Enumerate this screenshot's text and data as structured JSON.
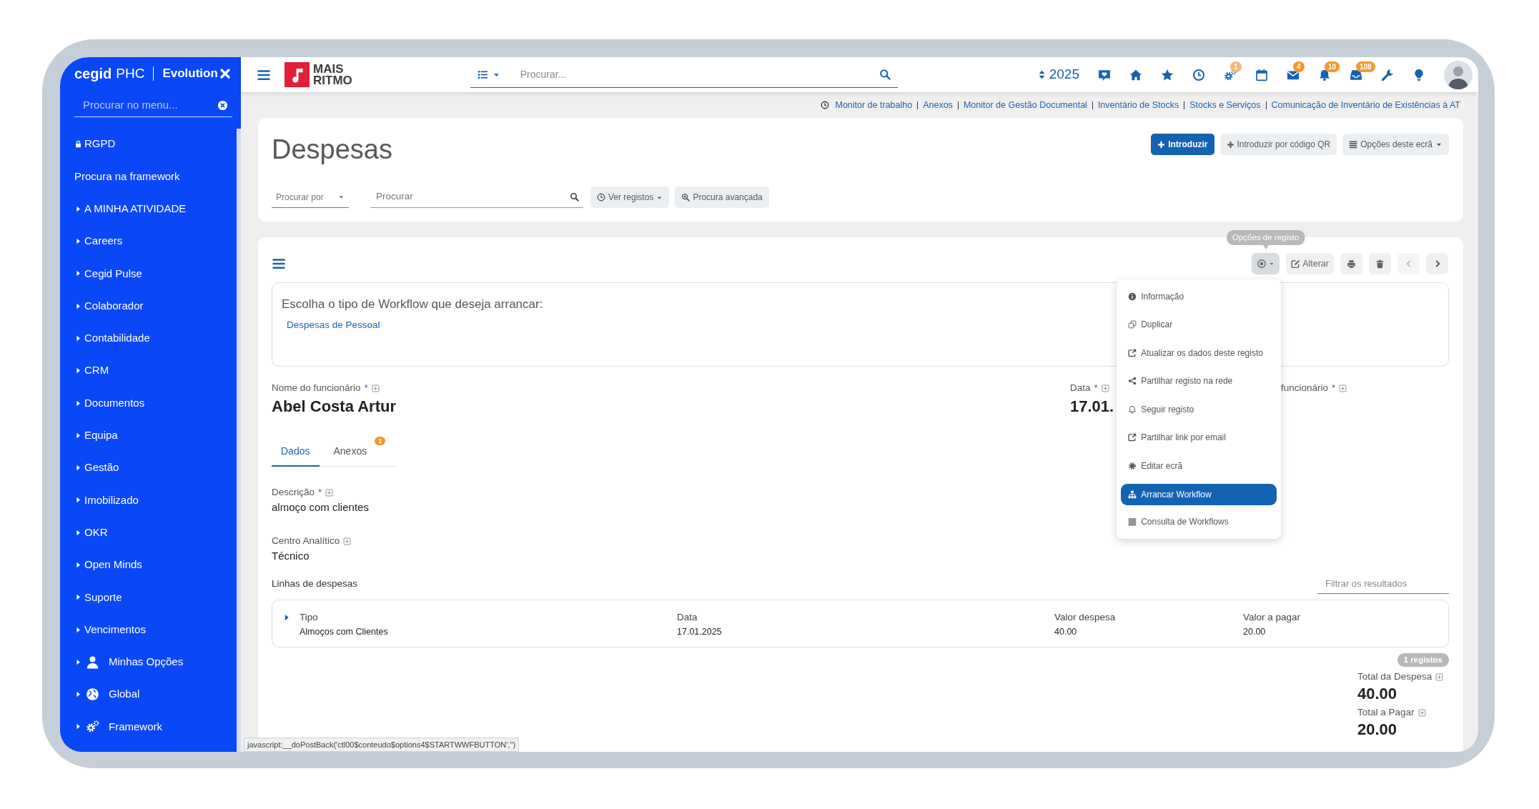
{
  "sidebar": {
    "brand": "cegid",
    "product": "PHC",
    "edition": "Evolution",
    "search": {
      "placeholder": "Procurar no menu..."
    },
    "items": [
      {
        "label": "RGPD",
        "kind": "link"
      },
      {
        "label": "Procura na framework",
        "kind": "link"
      },
      {
        "label": "A MINHA ATIVIDADE",
        "kind": "group"
      },
      {
        "label": "Careers",
        "kind": "group"
      },
      {
        "label": "Cegid Pulse",
        "kind": "group"
      },
      {
        "label": "Colaborador",
        "kind": "group"
      },
      {
        "label": "Contabilidade",
        "kind": "group"
      },
      {
        "label": "CRM",
        "kind": "group"
      },
      {
        "label": "Documentos",
        "kind": "group"
      },
      {
        "label": "Equipa",
        "kind": "group"
      },
      {
        "label": "Gestão",
        "kind": "group"
      },
      {
        "label": "Imobilizado",
        "kind": "group"
      },
      {
        "label": "OKR",
        "kind": "group"
      },
      {
        "label": "Open Minds",
        "kind": "group"
      },
      {
        "label": "Suporte",
        "kind": "group"
      },
      {
        "label": "Vencimentos",
        "kind": "group"
      },
      {
        "label": "Minhas Opções",
        "kind": "group"
      },
      {
        "label": "Global",
        "kind": "group"
      },
      {
        "label": "Framework",
        "kind": "group"
      }
    ]
  },
  "header": {
    "logo": [
      "MAIS",
      "RITMO"
    ],
    "search": {
      "placeholder": "Procurar..."
    },
    "year": "2025",
    "badges": [
      {
        "text": "1",
        "color": "#f6b47a"
      },
      {
        "text": "4",
        "color": "#f3982c"
      },
      {
        "text": "10",
        "color": "#f3982c"
      },
      {
        "text": "108",
        "color": "#f3982c"
      }
    ]
  },
  "breadcrumbs": [
    "Monitor de trabalho",
    "Anexos",
    "Monitor de Gestão Documental",
    "Inventário de Stocks",
    "Stocks e Serviços",
    "Comunicação de Inventário de Existências à AT"
  ],
  "list_panel": {
    "title": "Despesas",
    "actions": [
      {
        "label": "Introduzir",
        "kind": "primary"
      },
      {
        "label": "Introduzir por código QR",
        "kind": "qr"
      },
      {
        "label": "Opções deste ecrã",
        "kind": "dropdown"
      }
    ],
    "search_by": {
      "placeholder": "Procurar por"
    },
    "search": {
      "placeholder": "Procurar"
    },
    "buttons": [
      {
        "label": "Ver registos",
        "kind": "records"
      },
      {
        "label": "Procura avançada",
        "kind": "advanced"
      }
    ]
  },
  "record": {
    "edit_label": "Alterar",
    "tooltip": "Opções de registo",
    "menu_open": true,
    "pager": [
      {
        "disabled": true
      },
      {
        "disabled": false
      }
    ],
    "menu": [
      {
        "label": "Informação",
        "selected": false
      },
      {
        "label": "Duplicar",
        "selected": false
      },
      {
        "label": "Atualizar os dados deste registo",
        "selected": false
      },
      {
        "label": "Partilhar registo na rede",
        "selected": false
      },
      {
        "label": "Seguir registo",
        "selected": false
      },
      {
        "label": "Partilhar link por email",
        "selected": false
      },
      {
        "label": "Editar ecrã",
        "selected": false
      },
      {
        "label": "Arrancar Workflow",
        "selected": true
      },
      {
        "label": "Consulta de Workflows",
        "selected": false
      }
    ],
    "workflow": {
      "prompt": "Escolha o tipo de Workflow que deseja arrancar:",
      "link": "Despesas de Pessoal"
    },
    "header_fields": [
      {
        "label": "Nome do funcionário",
        "mark": "*",
        "value": "Abel Costa Artur"
      },
      {
        "label": "Data",
        "mark": "*",
        "value": "17.01."
      },
      {
        "label": "funcionário",
        "mark": "*"
      }
    ],
    "tabs": [
      {
        "label": "Dados",
        "selected": true
      },
      {
        "label": "Anexos",
        "selected": false,
        "badge": "1"
      }
    ],
    "fields": [
      {
        "label": "Descrição",
        "mark": "*",
        "value": "almoço com clientes"
      },
      {
        "label": "Centro Analítico",
        "value": "Técnico"
      }
    ],
    "lines": {
      "title": "Linhas de despesas",
      "filter": {
        "placeholder": "Filtrar os resultados"
      },
      "columns": [
        "Tipo",
        "Data",
        "Valor despesa",
        "Valor a pagar"
      ],
      "rows": [
        {
          "expanded": false,
          "cells": [
            "Almoços com Clientes",
            "17.01.2025",
            "40.00",
            "20.00"
          ]
        }
      ],
      "count": "1 registos"
    },
    "totals": [
      {
        "label": "Total da Despesa",
        "value": "40.00"
      },
      {
        "label": "Total a Pagar",
        "value": "20.00"
      }
    ]
  },
  "status_url": "javascript:__doPostBack('ctl00$conteudo$options4$STARTWWFBUTTON','')"
}
